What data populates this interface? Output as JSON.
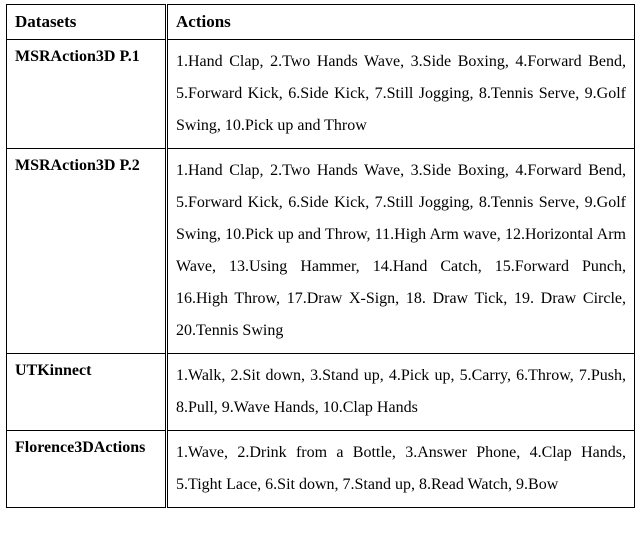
{
  "table": {
    "headers": {
      "datasets": "Datasets",
      "actions": "Actions"
    },
    "rows": [
      {
        "dataset": "MSRAction3D P.1",
        "actions": "1.Hand Clap, 2.Two Hands Wave, 3.Side Boxing, 4.Forward Bend, 5.Forward Kick, 6.Side Kick, 7.Still Jogging, 8.Tennis Serve, 9.Golf Swing, 10.Pick up and Throw"
      },
      {
        "dataset": "MSRAction3D P.2",
        "actions": "1.Hand Clap, 2.Two Hands Wave, 3.Side Boxing, 4.Forward Bend, 5.Forward Kick, 6.Side Kick, 7.Still Jogging, 8.Tennis Serve, 9.Golf Swing, 10.Pick up and Throw, 11.High Arm wave, 12.Horizontal Arm Wave, 13.Using Hammer, 14.Hand Catch, 15.Forward Punch, 16.High Throw, 17.Draw X-Sign, 18. Draw Tick, 19. Draw Circle, 20.Tennis Swing"
      },
      {
        "dataset": "UTKinnect",
        "actions": "1.Walk, 2.Sit down, 3.Stand up, 4.Pick up, 5.Carry, 6.Throw, 7.Push, 8.Pull, 9.Wave Hands, 10.Clap Hands"
      },
      {
        "dataset": "Florence3DActions",
        "actions": "1.Wave, 2.Drink from a Bottle, 3.Answer Phone, 4.Clap Hands, 5.Tight Lace, 6.Sit down, 7.Stand up, 8.Read Watch, 9.Bow"
      }
    ]
  }
}
